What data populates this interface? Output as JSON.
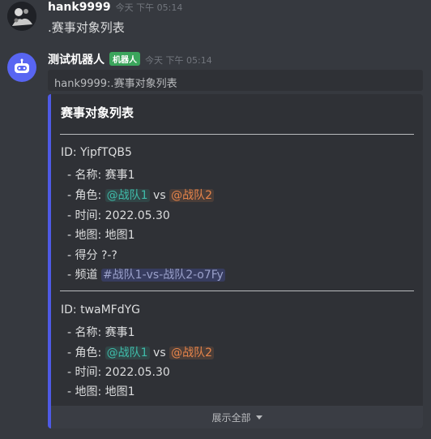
{
  "message1": {
    "username": "hank9999",
    "timestamp": "今天 下午 05:14",
    "content": ".赛事对象列表"
  },
  "message2": {
    "username": "测试机器人",
    "bot_tag": "机器人",
    "timestamp": "今天 下午 05:14",
    "quote": "hank9999:.赛事对象列表",
    "embed": {
      "accent_color": "#4e5ae6",
      "title": "赛事对象列表",
      "entries": [
        {
          "id_line": "ID: YipfTQB5",
          "name_line": "- 名称: 赛事1",
          "role_prefix": "- 角色: ",
          "team1": "@战队1",
          "vs": " vs ",
          "team2": "@战队2",
          "time_line": "- 时间: 2022.05.30",
          "map_line": "- 地图: 地图1",
          "score_line": "- 得分 ?-?",
          "channel_prefix": "- 频道 ",
          "channel": "#战队1-vs-战队2-o7Fy"
        },
        {
          "id_line": "ID: twaMFdYG",
          "name_line": "- 名称: 赛事1",
          "role_prefix": "- 角色: ",
          "team1": "@战队1",
          "vs": " vs ",
          "team2": "@战队2",
          "time_line": "- 时间: 2022.05.30",
          "map_line": "- 地图: 地图1"
        }
      ],
      "expand_label": "展示全部"
    }
  }
}
